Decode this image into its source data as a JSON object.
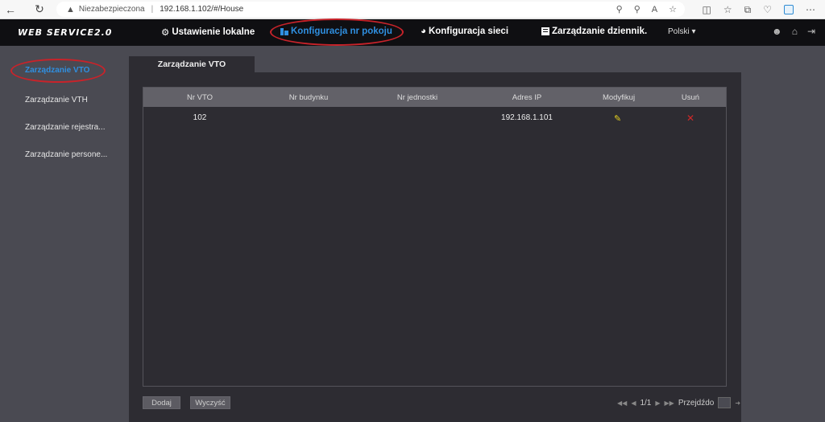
{
  "browser": {
    "warning_text": "Niezabezpieczona",
    "url": "192.168.1.102/#/House"
  },
  "header": {
    "logo": "WEB SERVICE2.0",
    "nav": [
      {
        "label": "Ustawienie lokalne",
        "icon": "gear-icon"
      },
      {
        "label": "Konfiguracja nr pokoju",
        "icon": "building-icon",
        "active": true
      },
      {
        "label": "Konfiguracja sieci",
        "icon": "globe-icon"
      },
      {
        "label": "Zarządzanie dziennik.",
        "icon": "log-icon"
      }
    ],
    "language": "Polski"
  },
  "sidebar": {
    "items": [
      {
        "label": "Zarządzanie VTO",
        "active": true
      },
      {
        "label": "Zarządzanie VTH"
      },
      {
        "label": "Zarządzanie rejestra..."
      },
      {
        "label": "Zarządzanie persone..."
      }
    ]
  },
  "main": {
    "tab_label": "Zarządzanie VTO",
    "table": {
      "columns": [
        "Nr VTO",
        "Nr budynku",
        "Nr jednostki",
        "Adres IP",
        "Modyfikuj",
        "Usuń"
      ],
      "rows": [
        {
          "nr_vto": "102",
          "nr_budynku": "",
          "nr_jednostki": "",
          "adres_ip": "192.168.1.101"
        }
      ]
    },
    "buttons": {
      "add": "Dodaj",
      "clear": "Wyczyść"
    },
    "pager": {
      "page": "1/1",
      "goto_label": "Przejdźdo"
    }
  },
  "colors": {
    "accent": "#2f8fe0",
    "annotation": "#c8232a",
    "header_bg": "#0f0f12",
    "panel_bg": "#2d2c32"
  }
}
